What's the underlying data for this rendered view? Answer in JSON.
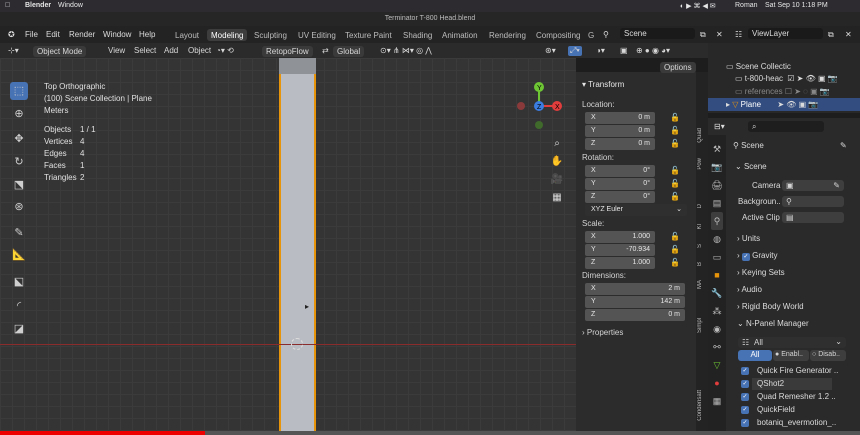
{
  "macbar": {
    "app": "Blender",
    "menu": "Window",
    "user": "Roman",
    "datetime": "Sat Sep 10  1:18 PM"
  },
  "title": "Terminator T-800 Head.blend",
  "menus": [
    "File",
    "Edit",
    "Render",
    "Window",
    "Help"
  ],
  "workspaces": [
    "Layout",
    "Modeling",
    "Sculpting",
    "UV Editing",
    "Texture Paint",
    "Shading",
    "Animation",
    "Rendering",
    "Compositing",
    "G"
  ],
  "active_workspace": "Modeling",
  "scene": "Scene",
  "view_layer": "ViewLayer",
  "header": {
    "mode": "Object Mode",
    "view": "View",
    "select": "Select",
    "add": "Add",
    "object": "Object",
    "retopo": "RetopoFlow",
    "orientation": "Global",
    "options": "Options"
  },
  "overlay_info": {
    "view": "Top Orthographic",
    "collection": "(100) Scene Collection | Plane",
    "units": "Meters",
    "stats": [
      {
        "k": "Objects",
        "v": "1 / 1"
      },
      {
        "k": "Vertices",
        "v": "4"
      },
      {
        "k": "Edges",
        "v": "4"
      },
      {
        "k": "Faces",
        "v": "1"
      },
      {
        "k": "Triangles",
        "v": "2"
      }
    ]
  },
  "gizmo": {
    "y": "Y",
    "z": "Z",
    "x": "X"
  },
  "transform": {
    "title": "Transform",
    "location_label": "Location:",
    "location": [
      {
        "k": "X",
        "v": "0 m"
      },
      {
        "k": "Y",
        "v": "0 m"
      },
      {
        "k": "Z",
        "v": "0 m"
      }
    ],
    "rotation_label": "Rotation:",
    "rotation": [
      {
        "k": "X",
        "v": "0°"
      },
      {
        "k": "Y",
        "v": "0°"
      },
      {
        "k": "Z",
        "v": "0°"
      }
    ],
    "rotation_mode": "XYZ Euler",
    "scale_label": "Scale:",
    "scale": [
      {
        "k": "X",
        "v": "1.000"
      },
      {
        "k": "Y",
        "v": "-70.934"
      },
      {
        "k": "Z",
        "v": "1.000"
      }
    ],
    "dimensions_label": "Dimensions:",
    "dimensions": [
      {
        "k": "X",
        "v": "2 m"
      },
      {
        "k": "Y",
        "v": "142 m"
      },
      {
        "k": "Z",
        "v": "0 m"
      }
    ],
    "properties": "Properties"
  },
  "ntabs": [
    "Quad",
    "Pow",
    "D",
    "Kl",
    "S",
    "B",
    "MA",
    "Simpl",
    "Condensatt"
  ],
  "outliner": {
    "root": "Scene Collectic",
    "items": [
      "t-800-heac",
      "references",
      "Plane"
    ]
  },
  "props": {
    "scene": "Scene",
    "section": "Scene",
    "camera": "Camera",
    "background": "Backgroun..",
    "active_clip": "Active Clip",
    "panels": [
      "Units",
      "Gravity",
      "Keying Sets",
      "Audio",
      "Rigid Body World",
      "N-Panel Manager"
    ],
    "filter": "All",
    "tabs": [
      "All",
      "Enabl..",
      "Disab.."
    ],
    "addons": [
      "Quick Fire Generator ..",
      "QShot2",
      "Quad Remesher 1.2 ..",
      "QuickField",
      "botaniq_evermotion_.."
    ]
  },
  "colors": {
    "accent": "#4772b3",
    "orange": "#e8940a",
    "gizmo_x": "#e23d3d",
    "gizmo_y": "#6ec634",
    "gizmo_z": "#3a7ce0"
  }
}
